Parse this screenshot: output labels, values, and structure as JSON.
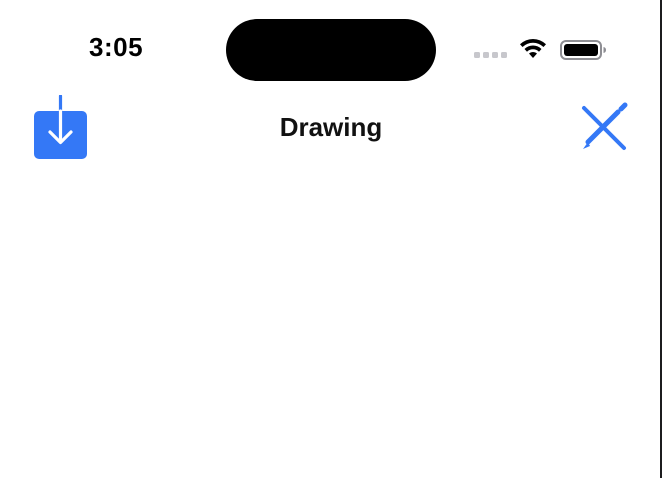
{
  "status_bar": {
    "time": "3:05",
    "icons": [
      "cellular-signal-icon",
      "wifi-icon",
      "battery-icon"
    ]
  },
  "nav_bar": {
    "title": "Drawing",
    "left_button_icon": "download-icon",
    "right_button_icon": "pencil-ruler-tools-icon"
  },
  "colors": {
    "accent": "#3478F6",
    "text": "#000000",
    "background": "#FFFFFF"
  }
}
